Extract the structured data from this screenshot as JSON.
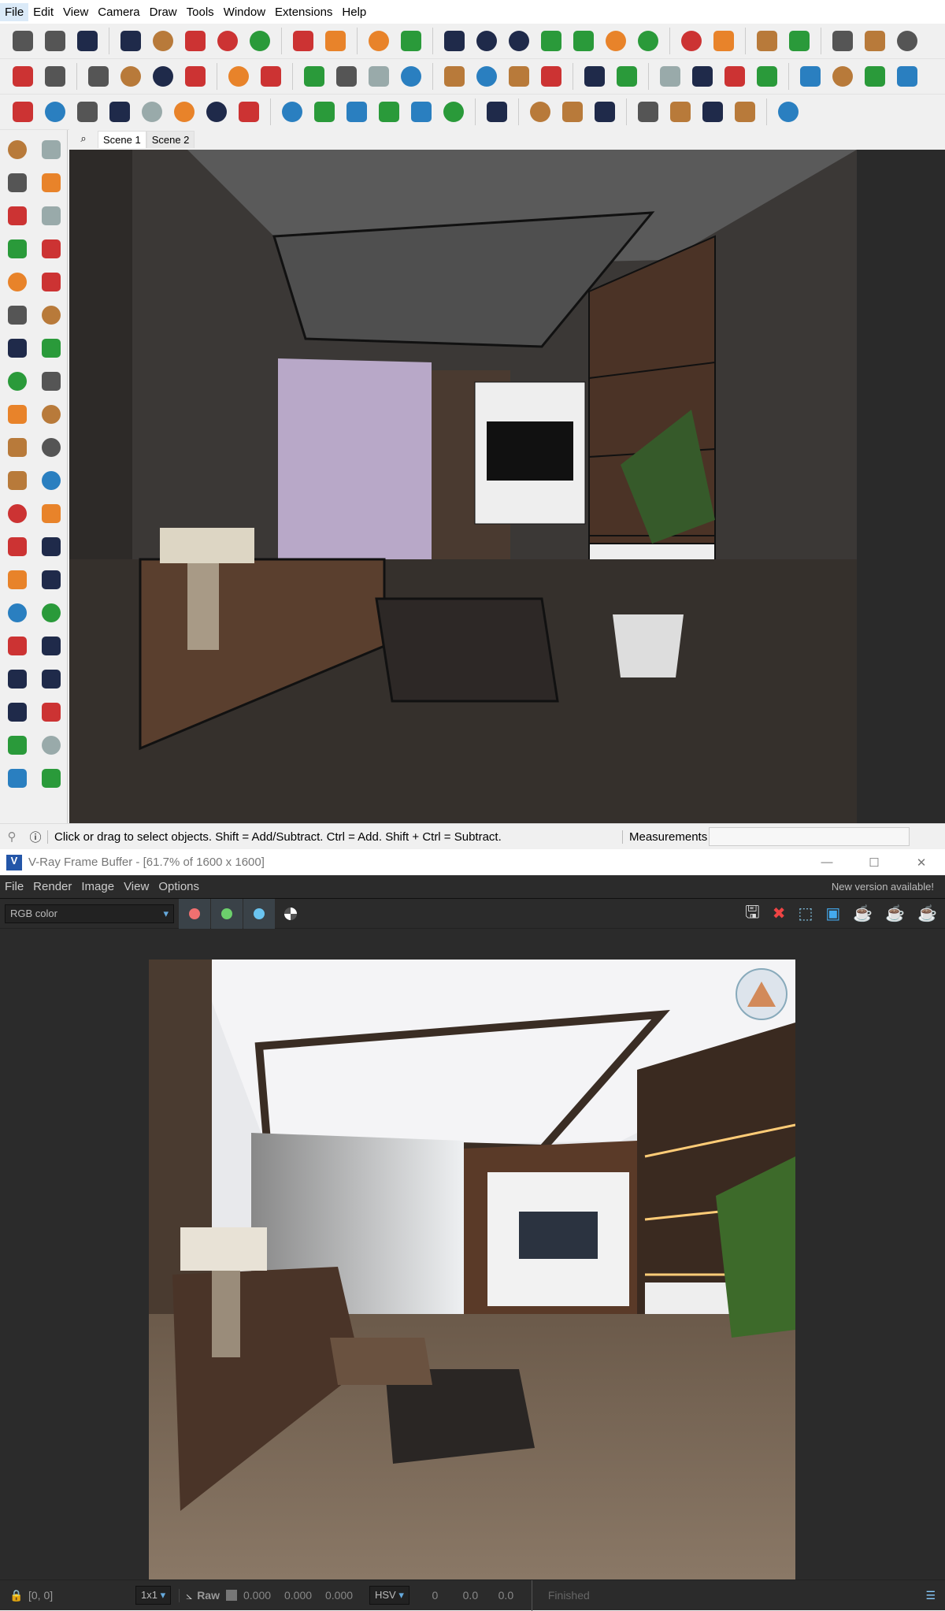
{
  "sketchup": {
    "menu": [
      "File",
      "Edit",
      "View",
      "Camera",
      "Draw",
      "Tools",
      "Window",
      "Extensions",
      "Help"
    ],
    "toolbar_row1": [
      "extension-warehouse-icon",
      "refresh-icon",
      "camera-swap-icon",
      "add-icon",
      "tree-icon",
      "material-icon",
      "sphere-icon",
      "cloud-upload-icon",
      "settings-icon",
      "mail-icon",
      "info-icon",
      "user-icon",
      "box-icon",
      "box-outline-icon",
      "box-x-icon",
      "box-plain-icon",
      "box-solid-icon",
      "layers-icon",
      "box-blue-icon",
      "style-a-icon",
      "style-b-icon",
      "axis-icon",
      "flip-blue-icon",
      "flip-red-icon",
      "scale-icon",
      "hourglass-icon"
    ],
    "toolbar_row2": [
      "vray-icon",
      "palette-icon",
      "teapot-icon",
      "teapot-interactive-icon",
      "fog-icon",
      "progressive-icon",
      "frame-buffer-icon",
      "frame-buffer-disabled-icon",
      "window-icon",
      "window-teapot-icon",
      "window-image-icon",
      "lock-icon",
      "arrow-horizontal-icon",
      "arrow-diagonal-icon",
      "arrow-vertical-icon",
      "zoom-icon",
      "help-icon",
      "gear-icon",
      "solid-union-icon",
      "solid-intersect-icon",
      "solid-subtract-icon",
      "solid-trim-icon",
      "section-icon",
      "view-iso-icon",
      "view-top-icon",
      "view-front-icon"
    ],
    "toolbar_row3": [
      "light-gen-icon",
      "spot-light-icon",
      "sphere-light-icon",
      "cone-light-icon",
      "ies-light-icon",
      "omni-light-icon",
      "dome-light-icon",
      "mesh-light-icon",
      "house-icon",
      "door-icon",
      "home-icon",
      "home-front-icon",
      "home-outline-icon",
      "home-roof-icon",
      "up-arrow-icon",
      "hand-icon",
      "list-icon",
      "play-icon",
      "slash-blue-icon",
      "slash-red-icon",
      "slash-red2-icon",
      "slash-pink-icon",
      "brick-icon"
    ],
    "left_tools": [
      "select-icon",
      "orbit-icon",
      "paint-icon",
      "eraser-icon",
      "component-icon",
      "tag-icon",
      "line-icon",
      "freehand-icon",
      "rectangle-icon",
      "rotated-rect-icon",
      "circle-icon",
      "polygon-icon",
      "arc-icon",
      "arc2-icon",
      "arc3-icon",
      "pie-icon",
      "move-icon",
      "push-pull-icon",
      "rotate-icon",
      "follow-me-icon",
      "scale-icon",
      "offset-icon",
      "tape-icon",
      "dimension-icon",
      "protractor-icon",
      "text-icon",
      "axes-icon",
      "3d-text-icon",
      "orbit2-icon",
      "pan-icon",
      "zoom-icon",
      "zoom-window-icon",
      "zoom-extents-icon",
      "previous-icon",
      "position-camera-icon",
      "look-around-icon",
      "walk-icon",
      "section-plane-icon",
      "solid-tools-icon",
      "sandbox-icon"
    ],
    "scenes": [
      "Scene 1",
      "Scene 2"
    ],
    "status_text": "Click or drag to select objects. Shift = Add/Subtract. Ctrl = Add. Shift + Ctrl = Subtract.",
    "measurements_label": "Measurements",
    "measurements_value": ""
  },
  "vfb": {
    "title": "V-Ray Frame Buffer - [61.7% of 1600 x 1600]",
    "menu": [
      "File",
      "Render",
      "Image",
      "View",
      "Options"
    ],
    "new_version": "New version available!",
    "channel": "RGB color",
    "coords": "[0, 0]",
    "sample_size": "1x1",
    "raw_label": "Raw",
    "rgb_values": [
      "0.000",
      "0.000",
      "0.000"
    ],
    "color_mode": "HSV",
    "hsv_values": [
      "0",
      "0.0",
      "0.0"
    ],
    "status": "Finished"
  }
}
